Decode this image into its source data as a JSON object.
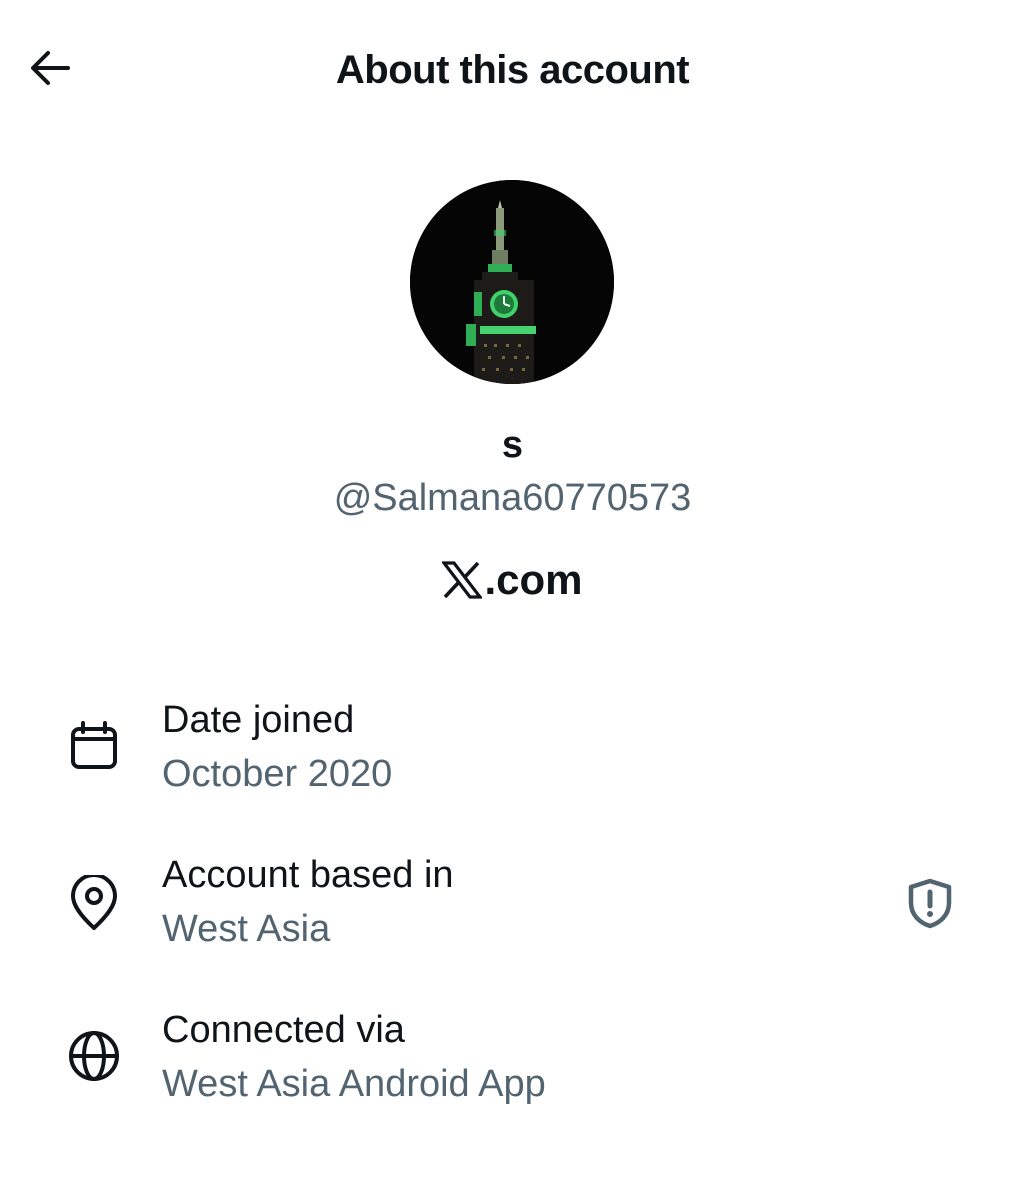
{
  "header": {
    "title": "About this account",
    "back_icon": "arrow-left-icon"
  },
  "profile": {
    "display_name": "s",
    "handle": "@Salmana60770573",
    "avatar_description_icon": "clock-tower-avatar",
    "source_logo_icon": "x-logo-icon",
    "source_suffix": ".com"
  },
  "details": [
    {
      "icon": "calendar-icon",
      "title": "Date joined",
      "value": "October 2020"
    },
    {
      "icon": "location-pin-icon",
      "title": "Account based in",
      "value": "West Asia",
      "trailing_icon": "shield-alert-icon"
    },
    {
      "icon": "globe-icon",
      "title": "Connected via",
      "value": "West Asia Android App"
    }
  ],
  "colors": {
    "primary_text": "#0f1419",
    "secondary_text": "#536471",
    "shield_gray": "#536471",
    "avatar_bg": "#050505",
    "tower_green": "#3fd16a"
  }
}
